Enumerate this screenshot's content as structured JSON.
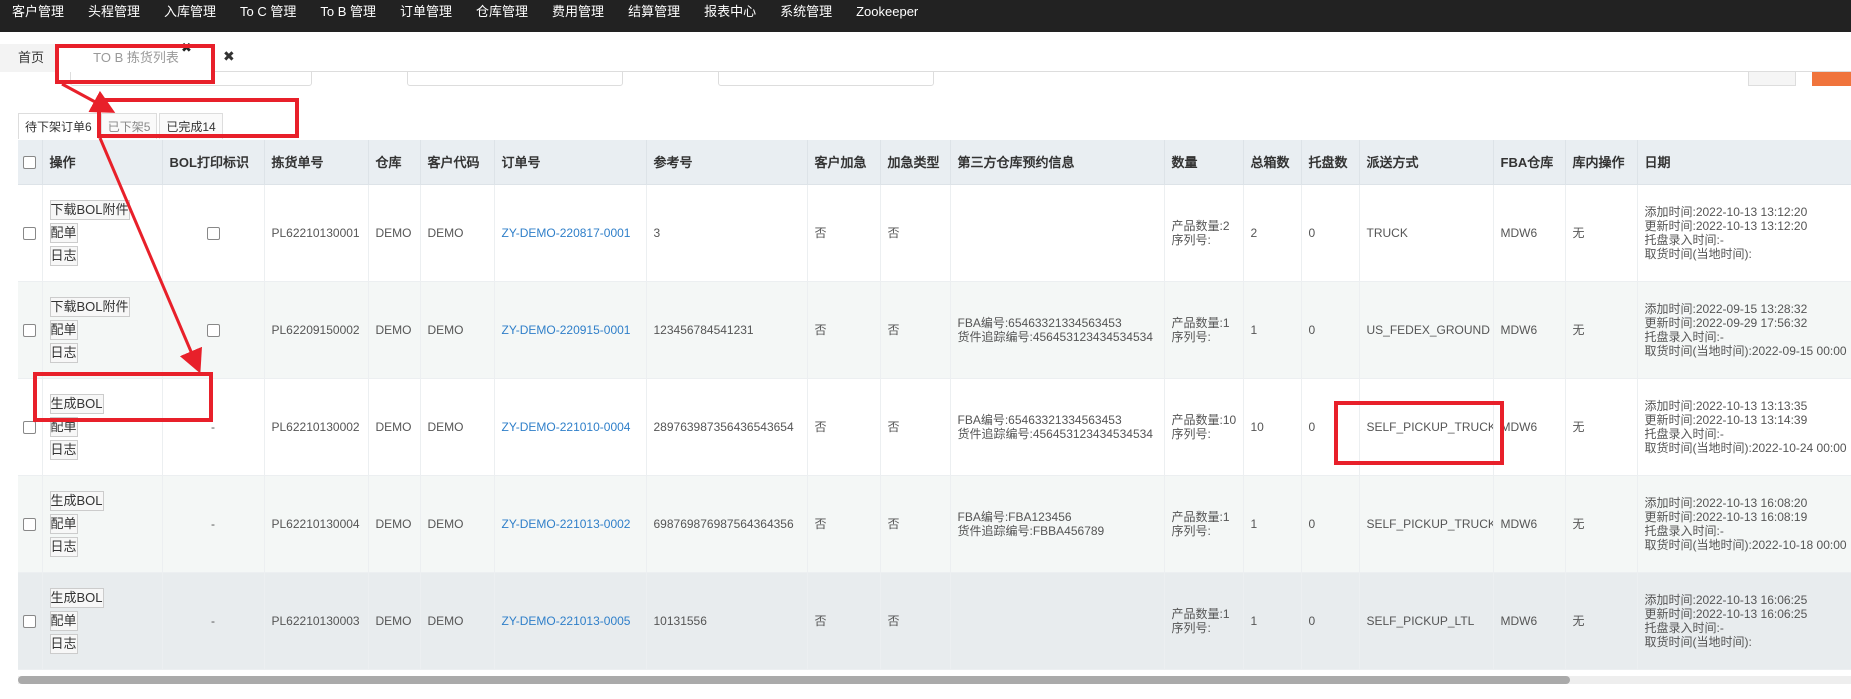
{
  "topnav": {
    "items": [
      "客户管理",
      "头程管理",
      "入库管理",
      "To C 管理",
      "To B 管理",
      "订单管理",
      "仓库管理",
      "费用管理",
      "结算管理",
      "报表中心",
      "系统管理",
      "Zookeeper"
    ]
  },
  "tabs": {
    "home": "首页",
    "active": "TO B 拣货列表",
    "close_glyph": "✖"
  },
  "status_tabs": [
    "待下架订单6",
    "已下架5",
    "已完成14"
  ],
  "table": {
    "headers": [
      "操作",
      "BOL打印标识",
      "拣货单号",
      "仓库",
      "客户代码",
      "订单号",
      "参考号",
      "客户加急",
      "加急类型",
      "第三方仓库预约信息",
      "数量",
      "总箱数",
      "托盘数",
      "派送方式",
      "FBA仓库",
      "库内操作",
      "日期"
    ],
    "rows": [
      {
        "ops": [
          "下载BOL附件",
          "配单",
          "日志"
        ],
        "bol_mark": "checkbox",
        "pick_no": "PL62210130001",
        "warehouse": "DEMO",
        "customer": "DEMO",
        "order_no": "ZY-DEMO-220817-0001",
        "ref_no": "3",
        "urgent": "否",
        "urgent_type": "否",
        "third_party": [
          "",
          ""
        ],
        "qty": [
          "产品数量:2",
          "序列号:"
        ],
        "boxes": "2",
        "pallets": "0",
        "delivery": "TRUCK",
        "fba": "MDW6",
        "inner": "无",
        "dates": [
          "添加时间:2022-10-13 13:12:20",
          "更新时间:2022-10-13 13:12:20",
          "托盘录入时间:-",
          "取货时间(当地时间):"
        ]
      },
      {
        "ops": [
          "下载BOL附件",
          "配单",
          "日志"
        ],
        "bol_mark": "checkbox",
        "pick_no": "PL62209150002",
        "warehouse": "DEMO",
        "customer": "DEMO",
        "order_no": "ZY-DEMO-220915-0001",
        "ref_no": "123456784541231",
        "urgent": "否",
        "urgent_type": "否",
        "third_party": [
          "FBA编号:65463321334563453",
          "货件追踪编号:456453123434534534"
        ],
        "qty": [
          "产品数量:1",
          "序列号:"
        ],
        "boxes": "1",
        "pallets": "0",
        "delivery": "US_FEDEX_GROUND",
        "fba": "MDW6",
        "inner": "无",
        "dates": [
          "添加时间:2022-09-15 13:28:32",
          "更新时间:2022-09-29 17:56:32",
          "托盘录入时间:-",
          "取货时间(当地时间):2022-09-15 00:00"
        ]
      },
      {
        "ops": [
          "生成BOL",
          "配单",
          "日志"
        ],
        "bol_mark": "-",
        "pick_no": "PL62210130002",
        "warehouse": "DEMO",
        "customer": "DEMO",
        "order_no": "ZY-DEMO-221010-0004",
        "ref_no": "289763987356436543654",
        "urgent": "否",
        "urgent_type": "否",
        "third_party": [
          "FBA编号:65463321334563453",
          "货件追踪编号:456453123434534534"
        ],
        "qty": [
          "产品数量:10",
          "序列号:"
        ],
        "boxes": "10",
        "pallets": "0",
        "delivery": "SELF_PICKUP_TRUCK",
        "fba": "MDW6",
        "inner": "无",
        "dates": [
          "添加时间:2022-10-13 13:13:35",
          "更新时间:2022-10-13 13:14:39",
          "托盘录入时间:-",
          "取货时间(当地时间):2022-10-24 00:00"
        ]
      },
      {
        "ops": [
          "生成BOL",
          "配单",
          "日志"
        ],
        "bol_mark": "-",
        "pick_no": "PL62210130004",
        "warehouse": "DEMO",
        "customer": "DEMO",
        "order_no": "ZY-DEMO-221013-0002",
        "ref_no": "698769876987564364356",
        "urgent": "否",
        "urgent_type": "否",
        "third_party": [
          "FBA编号:FBA123456",
          "货件追踪编号:FBBA456789"
        ],
        "qty": [
          "产品数量:1",
          "序列号:"
        ],
        "boxes": "1",
        "pallets": "0",
        "delivery": "SELF_PICKUP_TRUCK",
        "fba": "MDW6",
        "inner": "无",
        "dates": [
          "添加时间:2022-10-13 16:08:20",
          "更新时间:2022-10-13 16:08:19",
          "托盘录入时间:-",
          "取货时间(当地时间):2022-10-18 00:00"
        ]
      },
      {
        "ops": [
          "生成BOL",
          "配单",
          "日志"
        ],
        "bol_mark": "-",
        "pick_no": "PL62210130003",
        "warehouse": "DEMO",
        "customer": "DEMO",
        "order_no": "ZY-DEMO-221013-0005",
        "ref_no": "10131556",
        "urgent": "否",
        "urgent_type": "否",
        "third_party": [
          "",
          ""
        ],
        "qty": [
          "产品数量:1",
          "序列号:"
        ],
        "boxes": "1",
        "pallets": "0",
        "delivery": "SELF_PICKUP_LTL",
        "fba": "MDW6",
        "inner": "无",
        "dates": [
          "添加时间:2022-10-13 16:06:25",
          "更新时间:2022-10-13 16:06:25",
          "托盘录入时间:-",
          "取货时间(当地时间):"
        ]
      }
    ]
  },
  "colors": {
    "nav_bg": "#222222",
    "annotation": "#e8202a",
    "link": "#2f7fc9",
    "header_bg": "#e9eef2"
  }
}
